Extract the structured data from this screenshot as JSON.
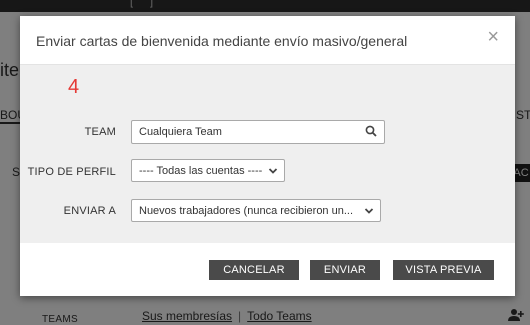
{
  "background": {
    "top_fragment_left": "[",
    "top_fragment_right": "]",
    "page_title": "ite",
    "tab_left": "BOU",
    "tab_right": "ST",
    "side_letter": "S",
    "action_button": "AC",
    "teams_label": "TEAMS",
    "links": [
      "Sus membresías",
      "Todo Teams"
    ],
    "separator": "|"
  },
  "modal": {
    "title": "Enviar cartas de bienvenida mediante envío masivo/general",
    "close_glyph": "×",
    "step_number": "4",
    "fields": {
      "team": {
        "label": "TEAM",
        "value": "Cualquiera Team"
      },
      "profile_type": {
        "label": "TIPO DE PERFIL",
        "value": "---- Todas las cuentas ----"
      },
      "send_to": {
        "label": "ENVIAR A",
        "value": "Nuevos trabajadores (nunca recibieron un..."
      }
    },
    "buttons": {
      "cancel": "CANCELAR",
      "send": "ENVIAR",
      "preview": "VISTA PREVIA"
    }
  },
  "colors": {
    "button_bg": "#4a4a4a",
    "step_number": "#e53935",
    "body_bg": "#efefef"
  },
  "icons": {
    "search": "search-icon",
    "chevron": "chevron-down-icon",
    "close": "close-icon",
    "add_user": "add-user-icon"
  }
}
